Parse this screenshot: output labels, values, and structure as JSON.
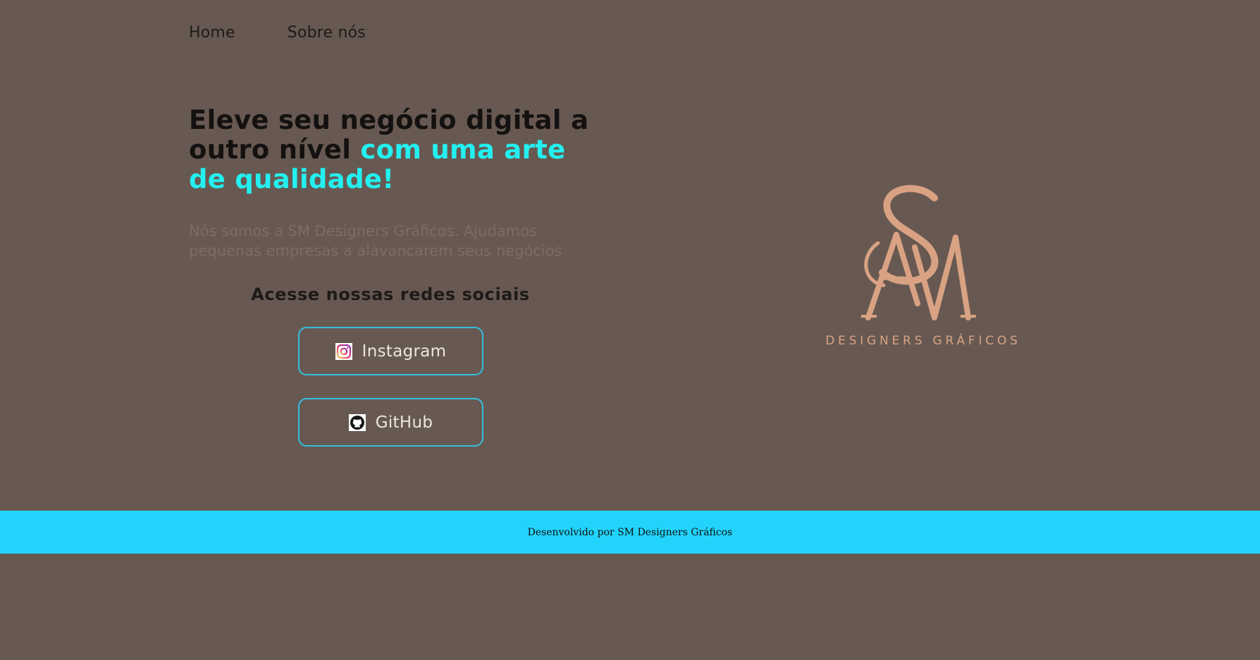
{
  "nav": {
    "items": [
      {
        "label": "Home"
      },
      {
        "label": "Sobre nós"
      }
    ]
  },
  "hero": {
    "headline_main": "Eleve seu negócio digital a outro nível ",
    "headline_accent": "com uma arte de qualidade!",
    "intro": "Nós somos a SM Designers Gráficos. Ajudamos pequenas empresas a alavancarem seus negócios"
  },
  "social": {
    "title": "Acesse nossas redes sociais",
    "buttons": [
      {
        "label": "Instagram",
        "icon": "instagram-icon"
      },
      {
        "label": "GitHub",
        "icon": "github-icon"
      }
    ]
  },
  "logo": {
    "monogram": "SM",
    "subtitle": "DESIGNERS GRÁFICOS"
  },
  "footer": {
    "text": "Desenvolvido por SM Designers Gráficos"
  },
  "colors": {
    "background": "#675952",
    "accent": "#23f0f0",
    "button_border": "#34bfe0",
    "logo": "#d9a283",
    "footer_bg": "#22d4fc"
  }
}
